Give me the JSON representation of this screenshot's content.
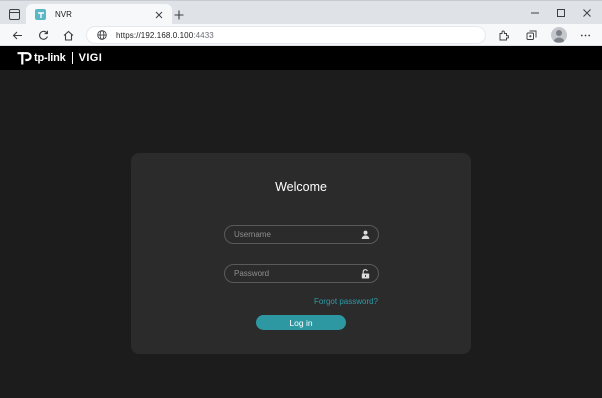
{
  "browser": {
    "tab": {
      "title": "NVR"
    },
    "address": {
      "url_main": "https://192.168.0.100",
      "url_port": ":4433"
    },
    "icons": {
      "tab_actions": "tab-actions-icon",
      "favicon": "tplink-favicon-icon",
      "tab_close": "close-icon",
      "new_tab": "plus-icon",
      "minimize": "minimize-icon",
      "maximize": "maximize-icon",
      "close_window": "close-icon",
      "back": "arrow-left-icon",
      "refresh": "refresh-icon",
      "home": "home-icon",
      "site_info": "globe-icon",
      "extensions": "extensions-icon",
      "collections": "collections-icon",
      "profile": "avatar-icon",
      "more": "more-icon"
    }
  },
  "header": {
    "brand": "tp-link",
    "product": "VIGI"
  },
  "login": {
    "title": "Welcome",
    "username_placeholder": "Username",
    "password_placeholder": "Password",
    "forgot_label": "Forgot password?",
    "login_label": "Log in"
  },
  "colors": {
    "page_bg": "#1c1c1c",
    "card_bg": "#2b2b2b",
    "header_bg": "#000000",
    "accent": "#2d98a1",
    "link": "#2e9aa8"
  }
}
